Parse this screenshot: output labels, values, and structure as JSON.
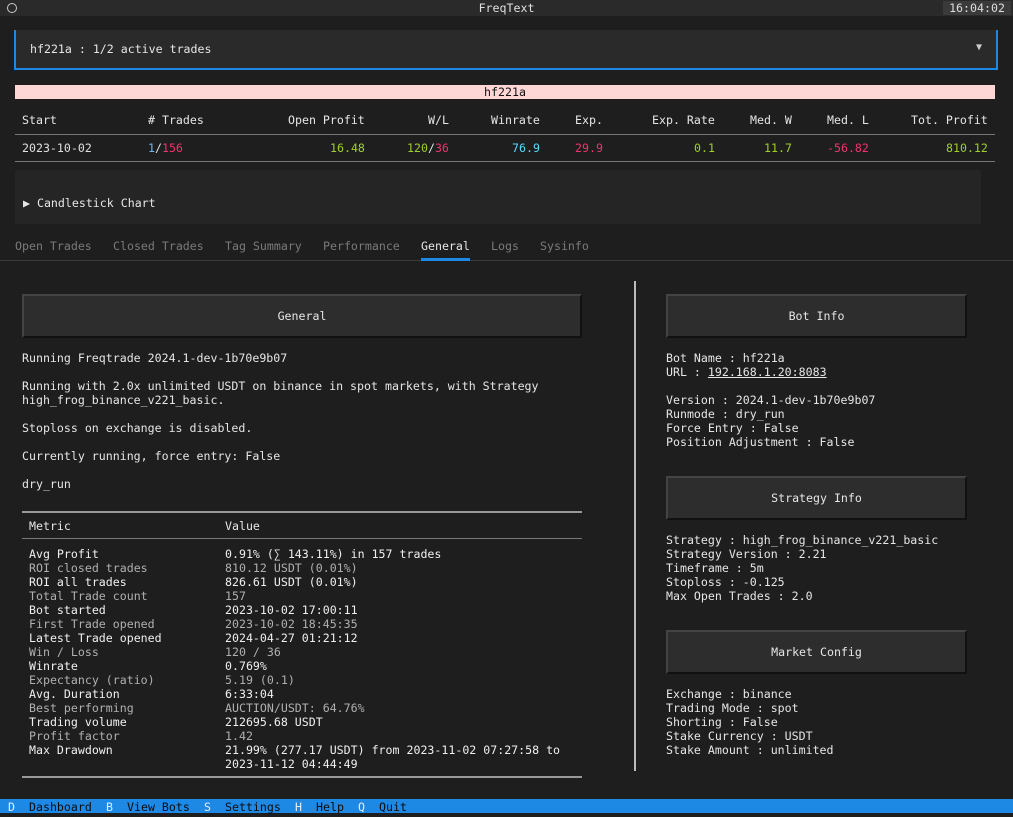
{
  "window": {
    "title": "FreqText",
    "clock": "16:04:02"
  },
  "selector": {
    "value": "hf221a : 1/2 active trades"
  },
  "bot_header": "hf221a",
  "summary": {
    "headers": [
      "Start",
      "# Trades",
      "Open Profit",
      "W/L",
      "Winrate",
      "Exp.",
      "Exp. Rate",
      "Med. W",
      "Med. L",
      "Tot. Profit"
    ],
    "start": "2023-10-02",
    "trades_open": "1",
    "trades_sep": "/",
    "trades_total": "156",
    "open_profit": "16.48",
    "wins": "120",
    "wl_sep": "/",
    "losses": "36",
    "winrate": "76.9",
    "exp": "29.9",
    "exp_rate": "0.1",
    "med_w": "11.7",
    "med_l": "-56.82",
    "tot_profit": "810.12"
  },
  "candlestick": {
    "arrow": "▶",
    "label": "Candlestick Chart"
  },
  "tabs": [
    {
      "label": "Open Trades"
    },
    {
      "label": "Closed Trades"
    },
    {
      "label": "Tag Summary"
    },
    {
      "label": "Performance"
    },
    {
      "label": "General",
      "active": true
    },
    {
      "label": "Logs"
    },
    {
      "label": "Sysinfo"
    }
  ],
  "general": {
    "title": "General",
    "lines": [
      "Running Freqtrade 2024.1-dev-1b70e9b07",
      "Running with 2.0x unlimited USDT on binance in spot markets, with Strategy",
      "high_frog_binance_v221_basic.",
      "Stoploss on exchange is disabled.",
      "Currently running, force entry: False",
      "dry_run"
    ],
    "metric_header": "Metric",
    "value_header": "Value",
    "metrics": [
      {
        "name": "Avg Profit",
        "value": "0.91% (∑ 143.11%) in 157 trades"
      },
      {
        "name": "ROI closed trades",
        "value": "810.12 USDT (0.01%)"
      },
      {
        "name": "ROI all trades",
        "value": "826.61 USDT (0.01%)"
      },
      {
        "name": "Total Trade count",
        "value": "157"
      },
      {
        "name": "Bot started",
        "value": "2023-10-02 17:00:11"
      },
      {
        "name": "First Trade opened",
        "value": "2023-10-02 18:45:35"
      },
      {
        "name": "Latest Trade opened",
        "value": "2024-04-27 01:21:12"
      },
      {
        "name": "Win / Loss",
        "value": "120 / 36"
      },
      {
        "name": "Winrate",
        "value": "0.769%"
      },
      {
        "name": "Expectancy (ratio)",
        "value": "5.19 (0.1)"
      },
      {
        "name": "Avg. Duration",
        "value": "6:33:04"
      },
      {
        "name": "Best performing",
        "value": "AUCTION/USDT: 64.76%"
      },
      {
        "name": "Trading volume",
        "value": "212695.68 USDT"
      },
      {
        "name": "Profit factor",
        "value": "1.42"
      },
      {
        "name": "Max Drawdown",
        "value": "21.99% (277.17 USDT) from 2023-11-02 07:27:58 to"
      }
    ],
    "max_drawdown_cont": "2023-11-12 04:44:49"
  },
  "bot_info": {
    "title": "Bot Info",
    "bot_name": "Bot Name : hf221a",
    "url_label": "URL : ",
    "url": "192.168.1.20:8083",
    "version": "Version : 2024.1-dev-1b70e9b07",
    "runmode": "Runmode : dry_run",
    "force_entry": "Force Entry : False",
    "position_adj": "Position Adjustment : False"
  },
  "strategy_info": {
    "title": "Strategy Info",
    "strategy": "Strategy : high_frog_binance_v221_basic",
    "version": "Strategy Version : 2.21",
    "timeframe": "Timeframe : 5m",
    "stoploss": "Stoploss : -0.125",
    "max_open": "Max Open Trades : 2.0"
  },
  "market_config": {
    "title": "Market Config",
    "exchange": "Exchange : binance",
    "trading_mode": "Trading Mode : spot",
    "shorting": "Shorting : False",
    "stake_currency": "Stake Currency : USDT",
    "stake_amount": "Stake Amount : unlimited"
  },
  "footer": [
    {
      "key": "D",
      "label": "Dashboard"
    },
    {
      "key": "B",
      "label": "View Bots"
    },
    {
      "key": "S",
      "label": "Settings"
    },
    {
      "key": "H",
      "label": "Help"
    },
    {
      "key": "Q",
      "label": "Quit"
    }
  ],
  "colors": {
    "accent": "#1e88e5",
    "positive": "#9fd02a",
    "negative": "#f0336e",
    "neutral": "#5fd7ff"
  }
}
